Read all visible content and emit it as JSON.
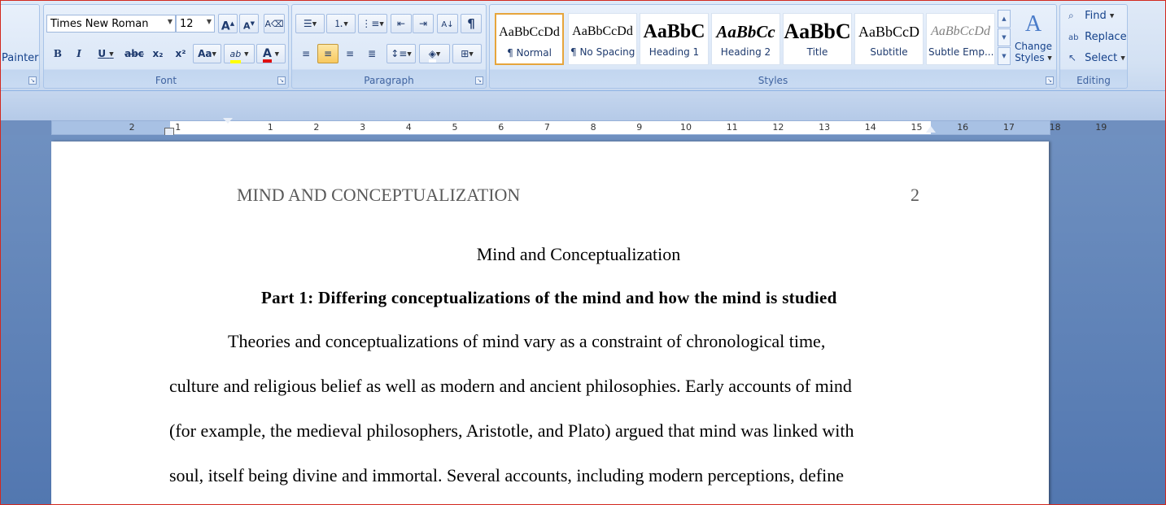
{
  "ribbon": {
    "clipboard": {
      "format_painter_label": "Painter"
    },
    "font": {
      "group_label": "Font",
      "font_name": "Times New Roman",
      "font_size": "12",
      "grow_label": "A",
      "shrink_label": "A",
      "bold_label": "B",
      "italic_label": "I",
      "underline_label": "U",
      "strike_label": "abc",
      "subscript_label": "x₂",
      "superscript_label": "x²",
      "case_label": "Aa",
      "highlight_label": "ab",
      "font_color_label": "A"
    },
    "paragraph": {
      "group_label": "Paragraph",
      "show_marks_label": "¶"
    },
    "styles": {
      "group_label": "Styles",
      "items": [
        {
          "sample": "AaBbCcDd",
          "name": "¶ Normal"
        },
        {
          "sample": "AaBbCcDd",
          "name": "¶ No Spacing"
        },
        {
          "sample": "AaBbC",
          "name": "Heading 1"
        },
        {
          "sample": "AaBbCc",
          "name": "Heading 2"
        },
        {
          "sample": "AaBbC",
          "name": "Title"
        },
        {
          "sample": "AaBbCcD",
          "name": "Subtitle"
        },
        {
          "sample": "AaBbCcDd",
          "name": "Subtle Emp..."
        }
      ],
      "change_styles_line1": "Change",
      "change_styles_line2": "Styles"
    },
    "editing": {
      "group_label": "Editing",
      "find_label": "Find",
      "replace_label": "Replace",
      "select_label": "Select"
    }
  },
  "ruler": {
    "left_labels": [
      "2",
      "1"
    ],
    "right_labels": [
      "1",
      "2",
      "3",
      "4",
      "5",
      "6",
      "7",
      "8",
      "9",
      "10",
      "11",
      "12",
      "13",
      "14",
      "15",
      "16",
      "17",
      "18",
      "19"
    ]
  },
  "document": {
    "header_title": "MIND AND CONCEPTUALIZATION",
    "page_number": "2",
    "title": "Mind and Conceptualization",
    "part_heading": "Part 1: Differing conceptualizations of the mind and how the mind is studied",
    "lines": [
      "Theories and conceptualizations of mind vary as a constraint of chronological time,",
      "culture and religious belief as well as modern and ancient philosophies. Early accounts of mind",
      "(for example, the medieval philosophers, Aristotle, and Plato) argued that mind was linked with",
      "soul, itself being divine and immortal. Several accounts, including modern perceptions, define"
    ]
  },
  "colors": {
    "accent": "#15428b",
    "ribbon_bg": "#dbe7f7",
    "workspace": "#6f90c0",
    "selected_style_border": "#e6a53c",
    "active_button": "#f8c95f",
    "window_border": "#d2281e"
  }
}
